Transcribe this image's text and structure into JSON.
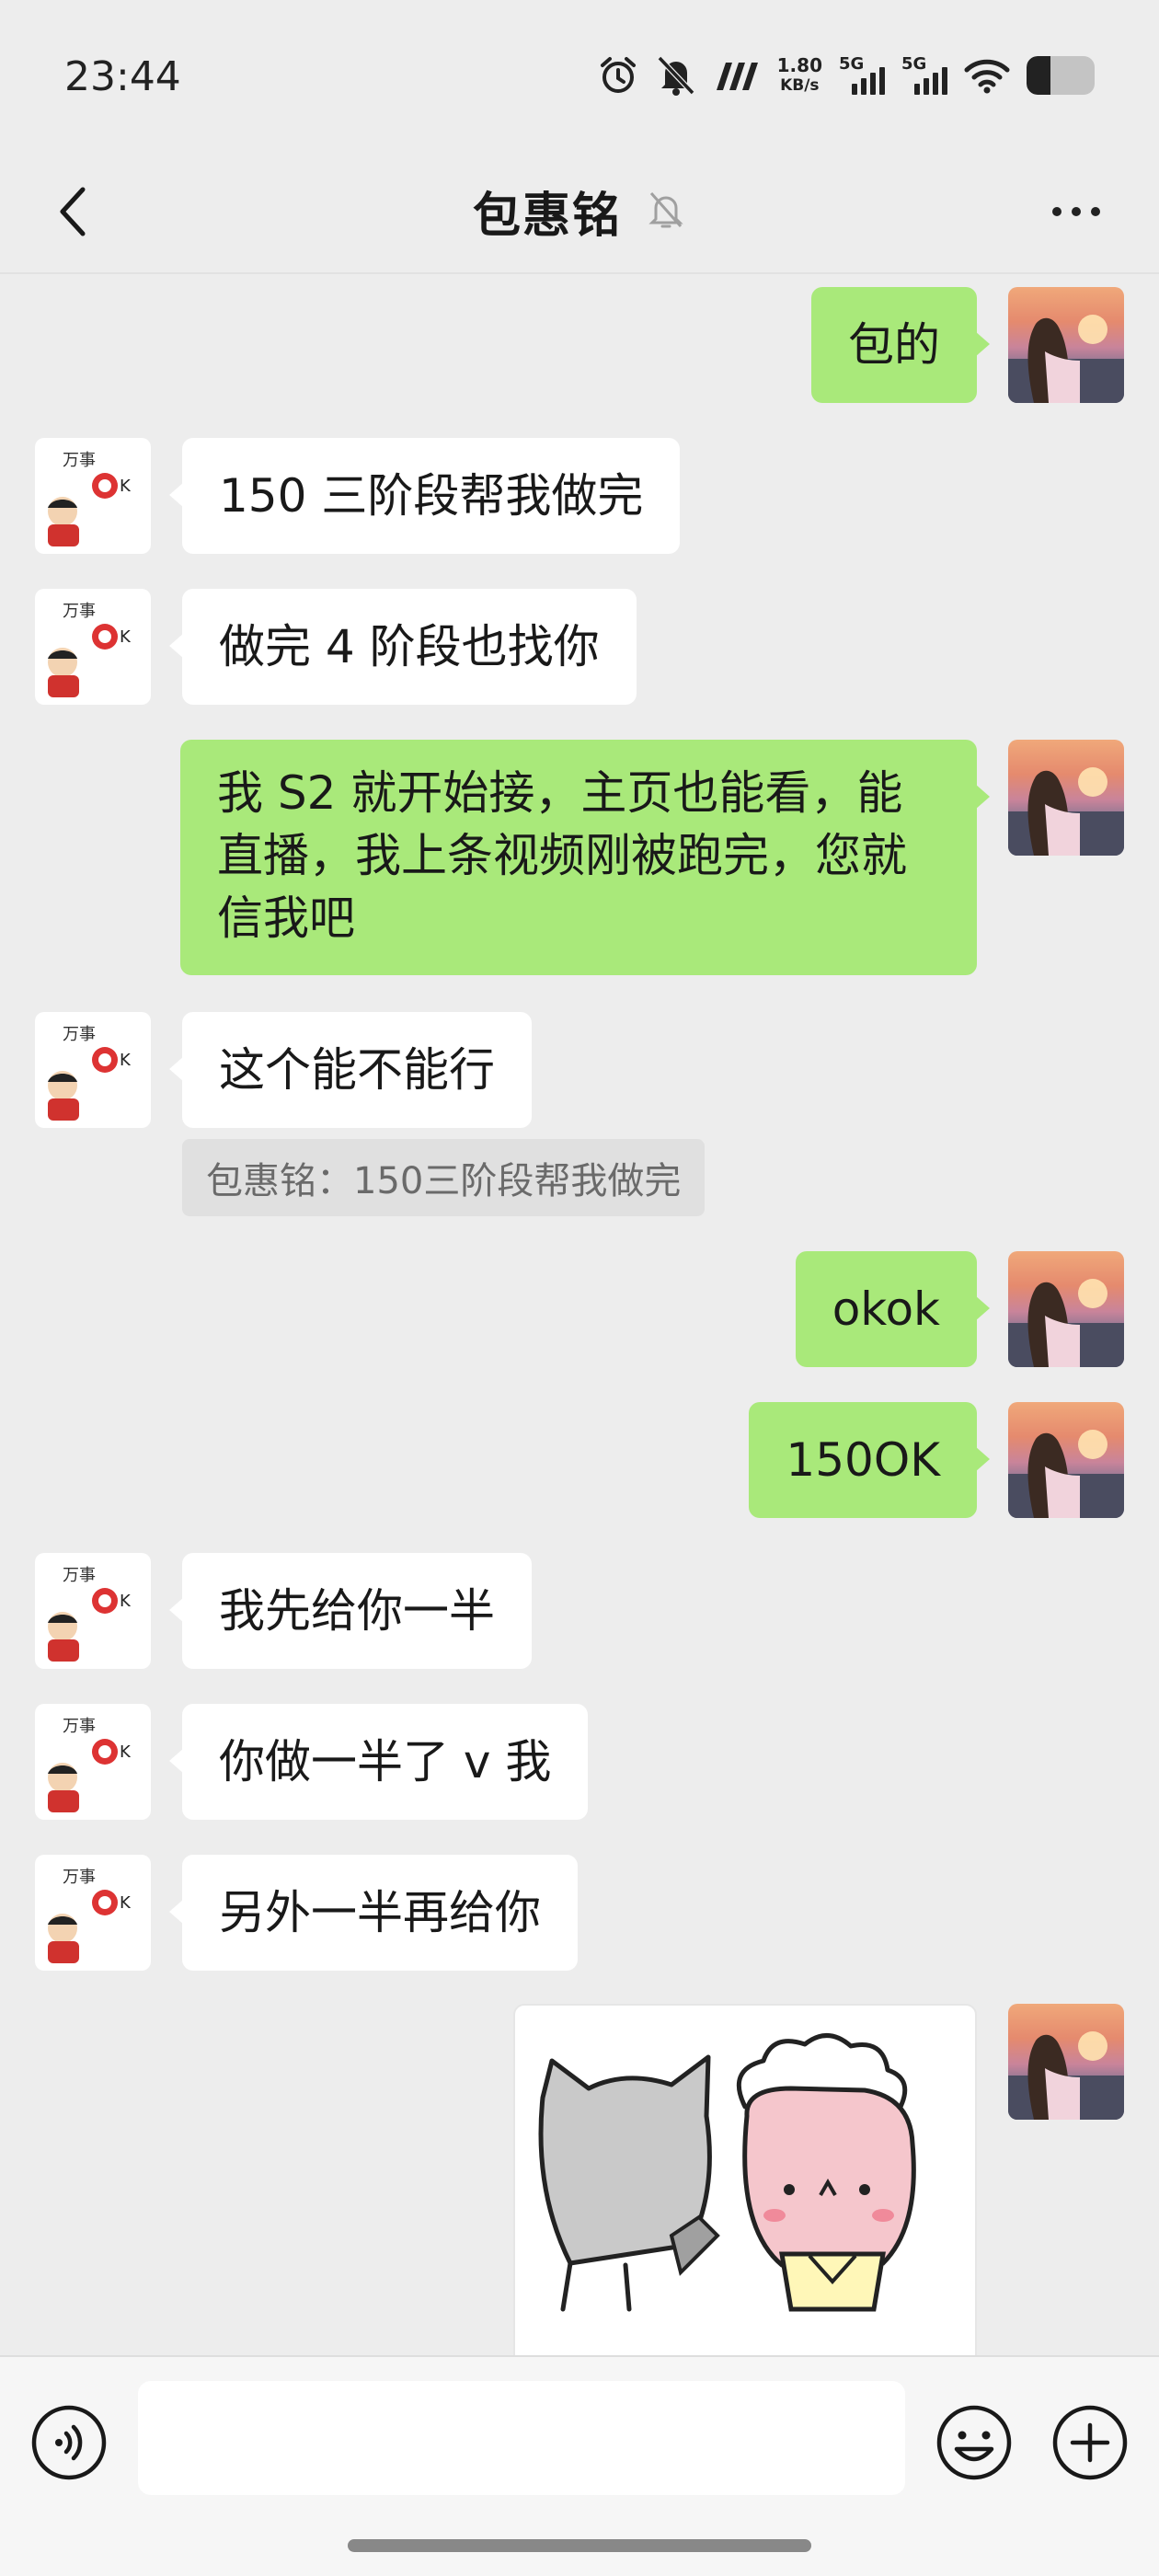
{
  "status_bar": {
    "time": "23:44",
    "net_speed_value": "1.80",
    "net_speed_unit": "KB/s",
    "sim1_label": "5G",
    "sim2_label": "5G",
    "battery_level": 0.35,
    "icons": [
      "alarm-icon",
      "mute-icon",
      "hd-icon",
      "signal-icon",
      "wifi-icon",
      "battery-icon"
    ]
  },
  "header": {
    "title": "包惠铭",
    "icons": [
      "back-icon",
      "notification-muted-icon",
      "more-icon"
    ]
  },
  "colors": {
    "background": "#ededed",
    "bubble_self": "#a9e97a",
    "bubble_other": "#ffffff",
    "quote_bg": "#e0e0e0"
  },
  "messages": [
    {
      "from": "self",
      "text": "包的"
    },
    {
      "from": "other",
      "text": "150 三阶段帮我做完"
    },
    {
      "from": "other",
      "text": "做完 4 阶段也找你"
    },
    {
      "from": "self",
      "lines": [
        "我 S2 就开始接，主页也能看，能",
        "直播，我上条视频刚被跑完，您就",
        "信我吧"
      ]
    },
    {
      "from": "other",
      "text": "这个能不能行",
      "quote": "包惠铭：150三阶段帮我做完"
    },
    {
      "from": "self",
      "text": "okok"
    },
    {
      "from": "self",
      "text": "150OK"
    },
    {
      "from": "other",
      "text": "我先给你一半"
    },
    {
      "from": "other",
      "text": "你做一半了 v 我"
    },
    {
      "from": "other",
      "text": "另外一半再给你"
    },
    {
      "from": "self",
      "type": "sticker",
      "sticker": "cat-and-rabbit-sticker"
    }
  ],
  "input_bar": {
    "value": "",
    "icons": [
      "voice-icon",
      "emoji-icon",
      "plus-icon"
    ]
  }
}
